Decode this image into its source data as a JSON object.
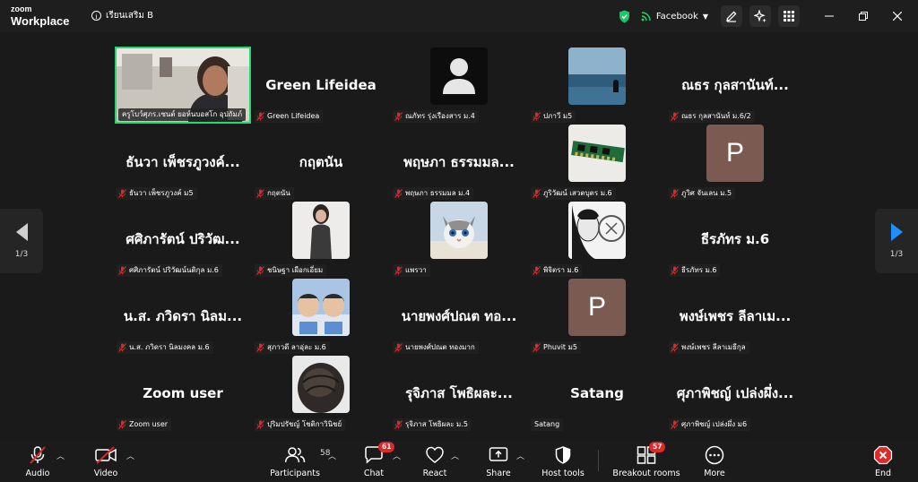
{
  "app": {
    "logo_top": "zoom",
    "logo_bottom": "Workplace",
    "meeting_title": "เรียนเสริม B"
  },
  "top_right": {
    "share_target": "Facebook"
  },
  "pager": {
    "left": "1/3",
    "right": "1/3"
  },
  "tiles": [
    {
      "kind": "video",
      "label": "ครูโบว์ศุภร.เซนต์ ยอห์นบอสโก อุปถัมภ์",
      "muted": false,
      "active": true
    },
    {
      "kind": "name",
      "display": "Green Lifeidea",
      "label": "Green Lifeidea",
      "muted": true
    },
    {
      "kind": "avatar-user",
      "label": "ณภัทร รุ่งเรืองสาร ม.4",
      "muted": true
    },
    {
      "kind": "avatar-sea",
      "label": "ปภาวี ม5",
      "muted": true
    },
    {
      "kind": "name",
      "display": "ณธร กุลสานันท์...",
      "label": "ณธร กุลสานันท์ ม.6/2",
      "muted": true
    },
    {
      "kind": "name",
      "display": "ธันวา เพ็ชรภูวงค์...",
      "label": "ธันวา เพ็ชรภูวงค์ ม5",
      "muted": true
    },
    {
      "kind": "name",
      "display": "กฤตนัน",
      "label": "กฤตนัน",
      "muted": true
    },
    {
      "kind": "name",
      "display": "พฤษภา ธรรมมล...",
      "label": "พฤษภา ธรรมมล ม.4",
      "muted": true
    },
    {
      "kind": "avatar-ram",
      "label": "ภูริวัฒน์ เสวตบุตร ม.6",
      "muted": true
    },
    {
      "kind": "avatar-letter",
      "letter": "P",
      "label": "ภูวิศ จันเลน ม.5",
      "muted": true
    },
    {
      "kind": "name",
      "display": "ศศิภารัตน์ ปริวัฒ...",
      "label": "ศศิภารัตน์ ปริวัฒน์นดิกุล ม.6",
      "muted": true
    },
    {
      "kind": "avatar-person",
      "label": "ชนิษฐา เผือกเอี่ยม",
      "muted": true
    },
    {
      "kind": "avatar-cat",
      "label": "แพรวา",
      "muted": true
    },
    {
      "kind": "avatar-anime",
      "label": "พิจิตรา ม.6",
      "muted": true
    },
    {
      "kind": "name",
      "display": "ธีรภัทร ม.6",
      "label": "ธีรภัทร ม.6",
      "muted": true
    },
    {
      "kind": "name",
      "display": "น.ส. ภวิดรา นิลม...",
      "label": "น.ส. ภวิดรา นิลมงคล ม.6",
      "muted": true
    },
    {
      "kind": "avatar-kids",
      "label": "สุภาวดี ลาอุ่ละ ม.6",
      "muted": true
    },
    {
      "kind": "name",
      "display": "นายพงศ์ปณต ทอ...",
      "label": "นายพงศ์ปณต ทองมาก",
      "muted": true
    },
    {
      "kind": "avatar-letter",
      "letter": "P",
      "label": "Phuvit ม5",
      "muted": true
    },
    {
      "kind": "name",
      "display": "พงษ์เพชร ลีลาเม...",
      "label": "พงษ์เพชร ลีลาเมธีกุล",
      "muted": true
    },
    {
      "kind": "name",
      "display": "Zoom user",
      "label": "Zoom user",
      "muted": true
    },
    {
      "kind": "avatar-hair",
      "label": "ปุริมปรัชญ์ โชติกาวินิชย์",
      "muted": true
    },
    {
      "kind": "name",
      "display": "รุจิภาส โพธิผละ...",
      "label": "รุจิภาส โพธิผละ ม.5",
      "muted": true
    },
    {
      "kind": "name",
      "display": "Satang",
      "label": "Satang",
      "muted": false
    },
    {
      "kind": "name",
      "display": "ศุภาพิชญ์ เปล่งผึ่ง...",
      "label": "ศุภาพิชญ์ เปล่งผึ่ง ม6",
      "muted": true
    }
  ],
  "toolbar": {
    "audio": "Audio",
    "video": "Video",
    "participants": "Participants",
    "participants_count": "58",
    "chat": "Chat",
    "chat_badge": "61",
    "react": "React",
    "share": "Share",
    "host_tools": "Host tools",
    "breakout": "Breakout rooms",
    "breakout_badge": "57",
    "more": "More",
    "end": "End"
  },
  "colors": {
    "accent": "#1f8fff",
    "active_speaker": "#23d96b",
    "mute_red": "#e02828",
    "shield_green": "#17c964"
  }
}
